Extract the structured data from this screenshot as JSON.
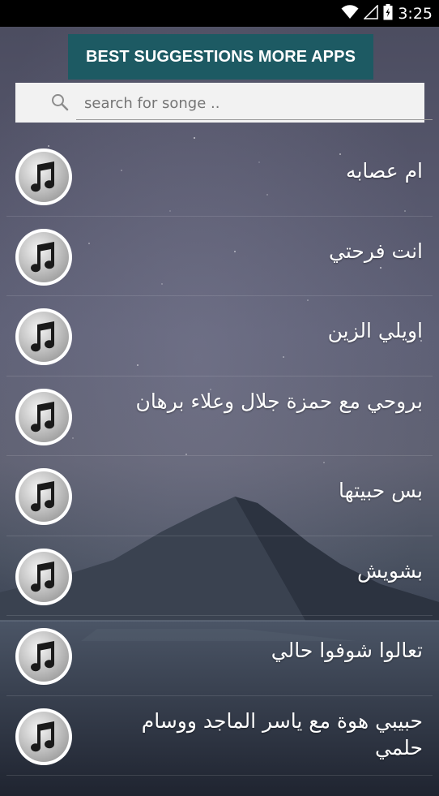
{
  "status_bar": {
    "time": "3:25",
    "icons": [
      "wifi-icon",
      "signal-icon",
      "battery-icon"
    ]
  },
  "banner": {
    "label": "BEST SUGGESTIONS MORE APPS",
    "color": "#1d5a63"
  },
  "search": {
    "placeholder": "search for songe ..",
    "icon": "search-icon"
  },
  "songs": [
    {
      "title": "ام عصابه",
      "icon": "music-note-icon"
    },
    {
      "title": "انت فرحتي",
      "icon": "music-note-icon"
    },
    {
      "title": "اويلي الزين",
      "icon": "music-note-icon"
    },
    {
      "title": "بروحي مع حمزة جلال وعلاء برهان",
      "icon": "music-note-icon"
    },
    {
      "title": "بس حبيتها",
      "icon": "music-note-icon"
    },
    {
      "title": "بشويش",
      "icon": "music-note-icon"
    },
    {
      "title": "تعالوا شوفوا حالي",
      "icon": "music-note-icon"
    },
    {
      "title": "حبيبي هوة مع ياسر الماجد ووسام حلمي",
      "icon": "music-note-icon"
    }
  ]
}
